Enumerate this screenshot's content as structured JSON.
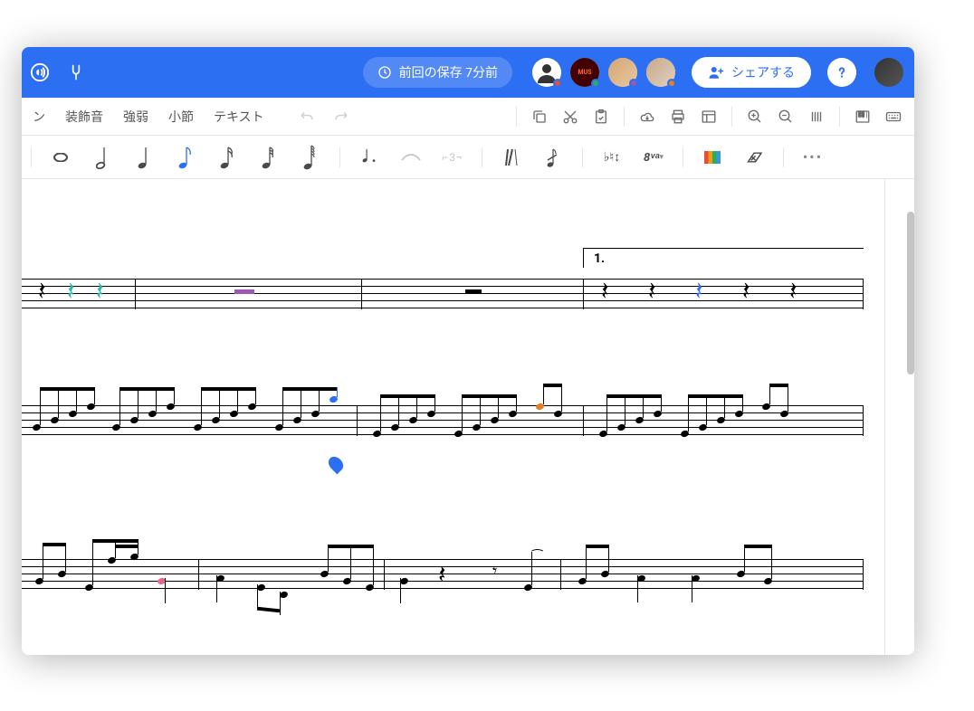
{
  "header": {
    "save_status": "前回の保存 7分前",
    "share_label": "シェアする",
    "collaborators": [
      {
        "status_color": "#e74c3c",
        "type": "icon"
      },
      {
        "status_color": "#27ae60",
        "type": "badge"
      },
      {
        "status_color": "#9b59b6",
        "type": "photo1"
      },
      {
        "status_color": "#e67e22",
        "type": "photo2"
      }
    ]
  },
  "menubar": {
    "items": [
      "ン",
      "装飾音",
      "強弱",
      "小節",
      "テキスト"
    ]
  },
  "note_toolbar": {
    "ottava_label": "8ᵛᵃ",
    "triplet_label": "3"
  },
  "score": {
    "volta_label": "1."
  }
}
